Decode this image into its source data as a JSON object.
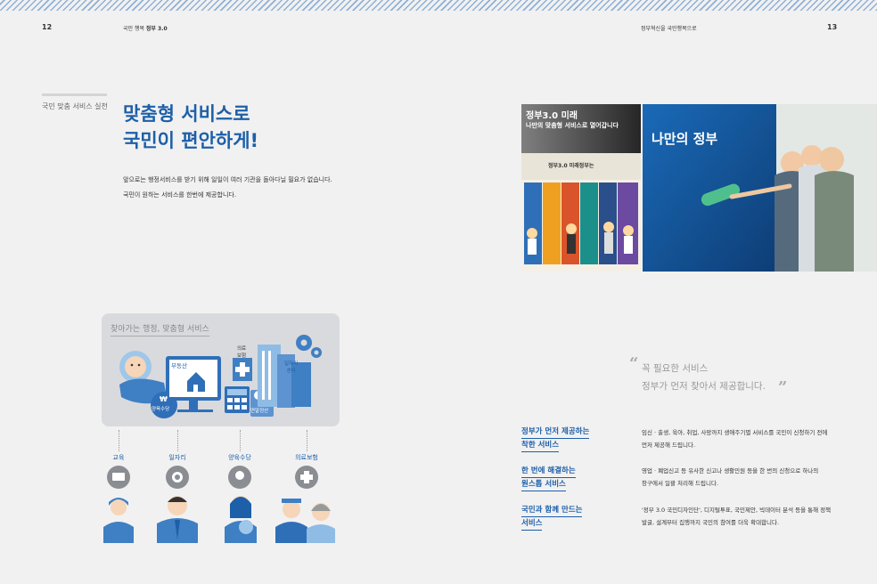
{
  "header": {
    "left_page_num": "12",
    "left_title_pre": "국민 행복 ",
    "left_title_bold": "정부 3.0",
    "right_title": "정부혁신을 국민행복으로",
    "right_page_num": "13"
  },
  "section_label": "국민 맞춤 서비스 실천",
  "title": {
    "line1": "맞춤형 서비스로",
    "line2": "국민이 편안하게!"
  },
  "intro": {
    "line1": "앞으로는 행정서비스를 받기 위해 일일이 여러 기관을 돌아다닐 필요가 없습니다.",
    "line2": "국민이 원하는 서비스를 한번에 제공합니다."
  },
  "photo1": {
    "sign_line1": "정부3.0 미래",
    "sign_line2": "나만의 맞춤형 서비스로 열어갑니다",
    "board": "정부3.0 미래정부는"
  },
  "photo2": {
    "screen": "나만의 정부"
  },
  "illustration": {
    "title": "찾아가는 행정, 맞춤형 서비스",
    "labels": {
      "real_estate": "부동산",
      "medical": "의료\n보험",
      "jobs_center": "일자리\n센터",
      "child_allowance": "양육수당",
      "year_end": "연말정산",
      "won": "₩"
    }
  },
  "services_icons": [
    {
      "label": "교육",
      "icon": "monitor-icon"
    },
    {
      "label": "일자리",
      "icon": "gear-person-icon"
    },
    {
      "label": "양육수당",
      "icon": "baby-icon"
    },
    {
      "label": "의료보험",
      "icon": "medical-cross-icon"
    }
  ],
  "quote": {
    "line1": "꼭 필요한 서비스",
    "line2": "정부가 먼저 찾아서 제공합니다."
  },
  "services": [
    {
      "head1": "정부가 먼저 제공하는",
      "head2": "착한 서비스",
      "text1": "임신 · 출생, 육아, 취업, 사망까지 생애주기별 서비스를 국민이 신청하기 전에",
      "text2": "먼저 제공해 드립니다."
    },
    {
      "head1": "한 번에 해결하는",
      "head2": "원스톱 서비스",
      "text1": "영업 · 폐업신고 등 유사한 신고나 생활민원 등을 한 번의 신청으로 하나의",
      "text2": "창구에서 일괄 처리해 드립니다."
    },
    {
      "head1": "국민과 함께 만드는",
      "head2": "서비스",
      "text1": "'정부 3.0 국민디자인단', 디지털투표, 국민제안, 빅데이터 분석 등을 통해 정책",
      "text2": "발굴, 설계부터 집행까지 국민의 참여를 더욱 확대합니다."
    }
  ],
  "colors": {
    "accent": "#1d5fa8",
    "icon_blue": "#3f7fc3",
    "gray_bg": "#d9dadd"
  }
}
